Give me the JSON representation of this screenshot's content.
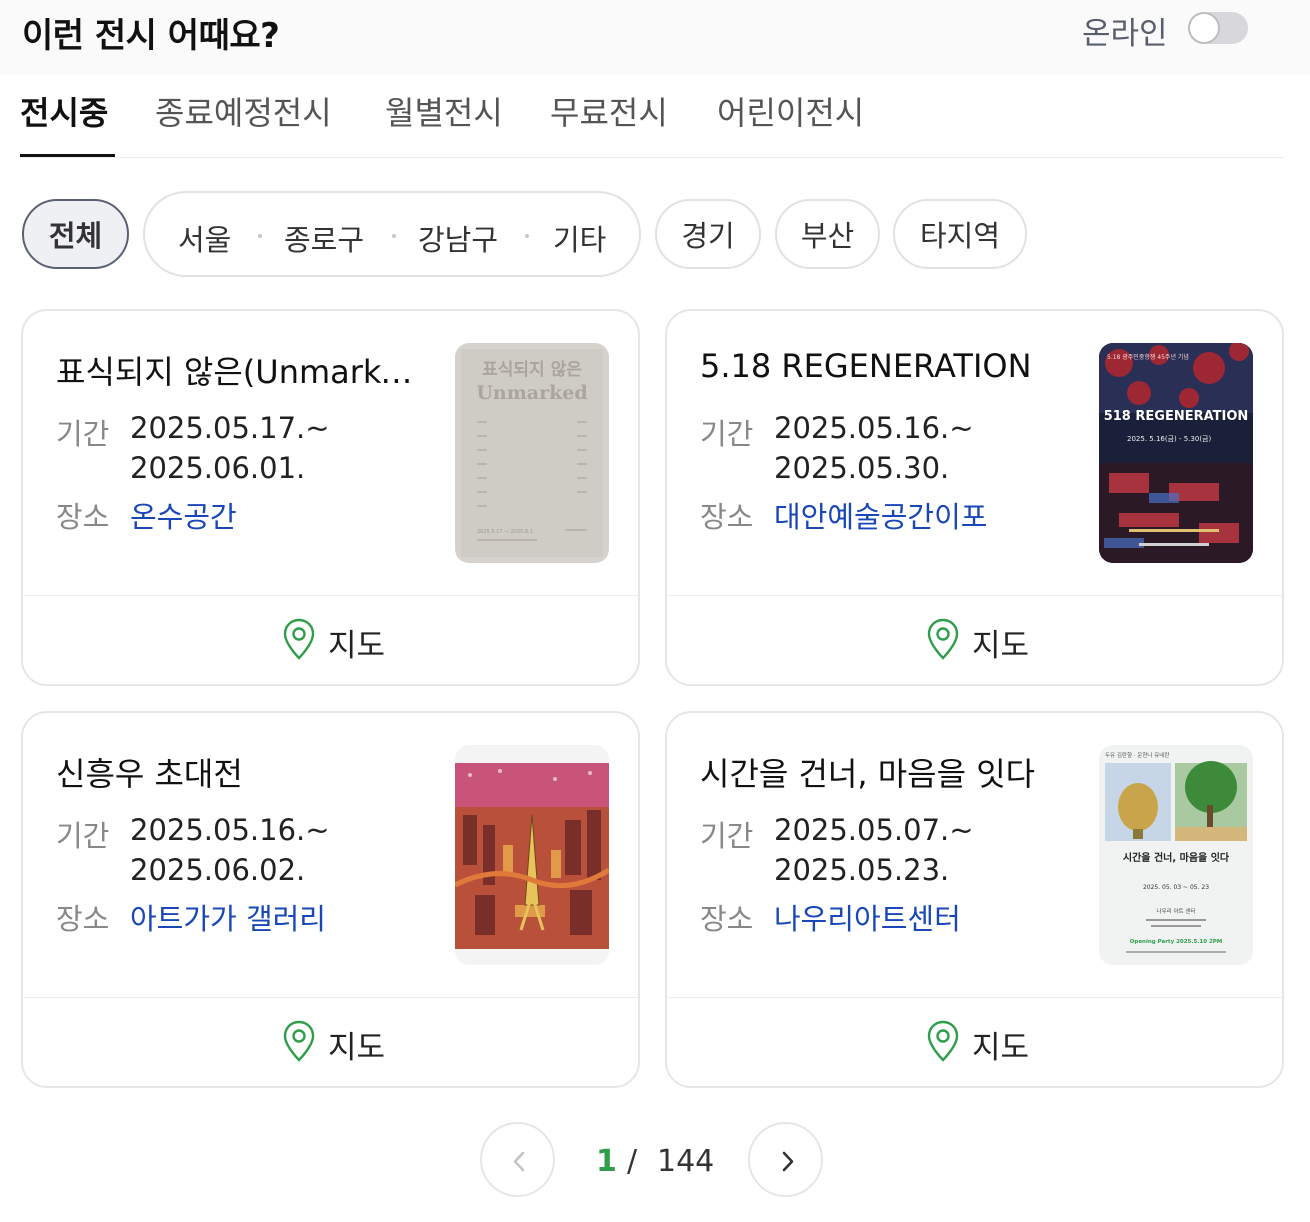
{
  "header": {
    "title": "이런 전시 어때요?",
    "online_label": "온라인",
    "online_enabled": false
  },
  "tabs": [
    {
      "label": "전시중",
      "active": true
    },
    {
      "label": "종료예정전시",
      "active": false
    },
    {
      "label": "월별전시",
      "active": false
    },
    {
      "label": "무료전시",
      "active": false
    },
    {
      "label": "어린이전시",
      "active": false
    }
  ],
  "regions": {
    "all": "전체",
    "seoul_group": [
      "서울",
      "종로구",
      "강남구",
      "기타"
    ],
    "others": [
      "경기",
      "부산",
      "타지역"
    ]
  },
  "labels": {
    "period": "기간",
    "venue": "장소",
    "map": "지도"
  },
  "exhibitions": [
    {
      "name": "표식되지 않은(Unmarked)",
      "start": "2025.05.17.~",
      "end": "2025.06.01.",
      "venue": "온수공간",
      "poster": {
        "title_ko": "표식되지 않은",
        "title_en": "Unmarked",
        "footer": "2025.5.17 — 2025.6.1"
      }
    },
    {
      "name": "5.18 REGENERATION",
      "start": "2025.05.16.~",
      "end": "2025.05.30.",
      "venue": "대안예술공간이포",
      "poster": {
        "top": "5.18 광주민중항쟁 45주년 기념",
        "title": "518 REGENERATION",
        "dates": "2025. 5.16(금) - 5.30(금)"
      }
    },
    {
      "name": "신흥우 초대전",
      "start": "2025.05.16.~",
      "end": "2025.06.02.",
      "venue": "아트가가 갤러리"
    },
    {
      "name": "시간을 건너, 마음을 잇다",
      "start": "2025.05.07.~",
      "end": "2025.05.23.",
      "venue": "나우리아트센터",
      "poster": {
        "top": "두유 김란향 · 운현나 유네란",
        "title": "시간을 건너, 마음을 잇다",
        "dates": "2025. 05. 03  ~  05. 23",
        "place": "나우리 아트 센터",
        "party": "Opening Party 2025.5.10 2PM"
      }
    }
  ],
  "pagination": {
    "current": "1",
    "separator": "/",
    "total": "144"
  },
  "colors": {
    "accent_green": "#2e9e4b",
    "venue_blue": "#1a47b8"
  }
}
